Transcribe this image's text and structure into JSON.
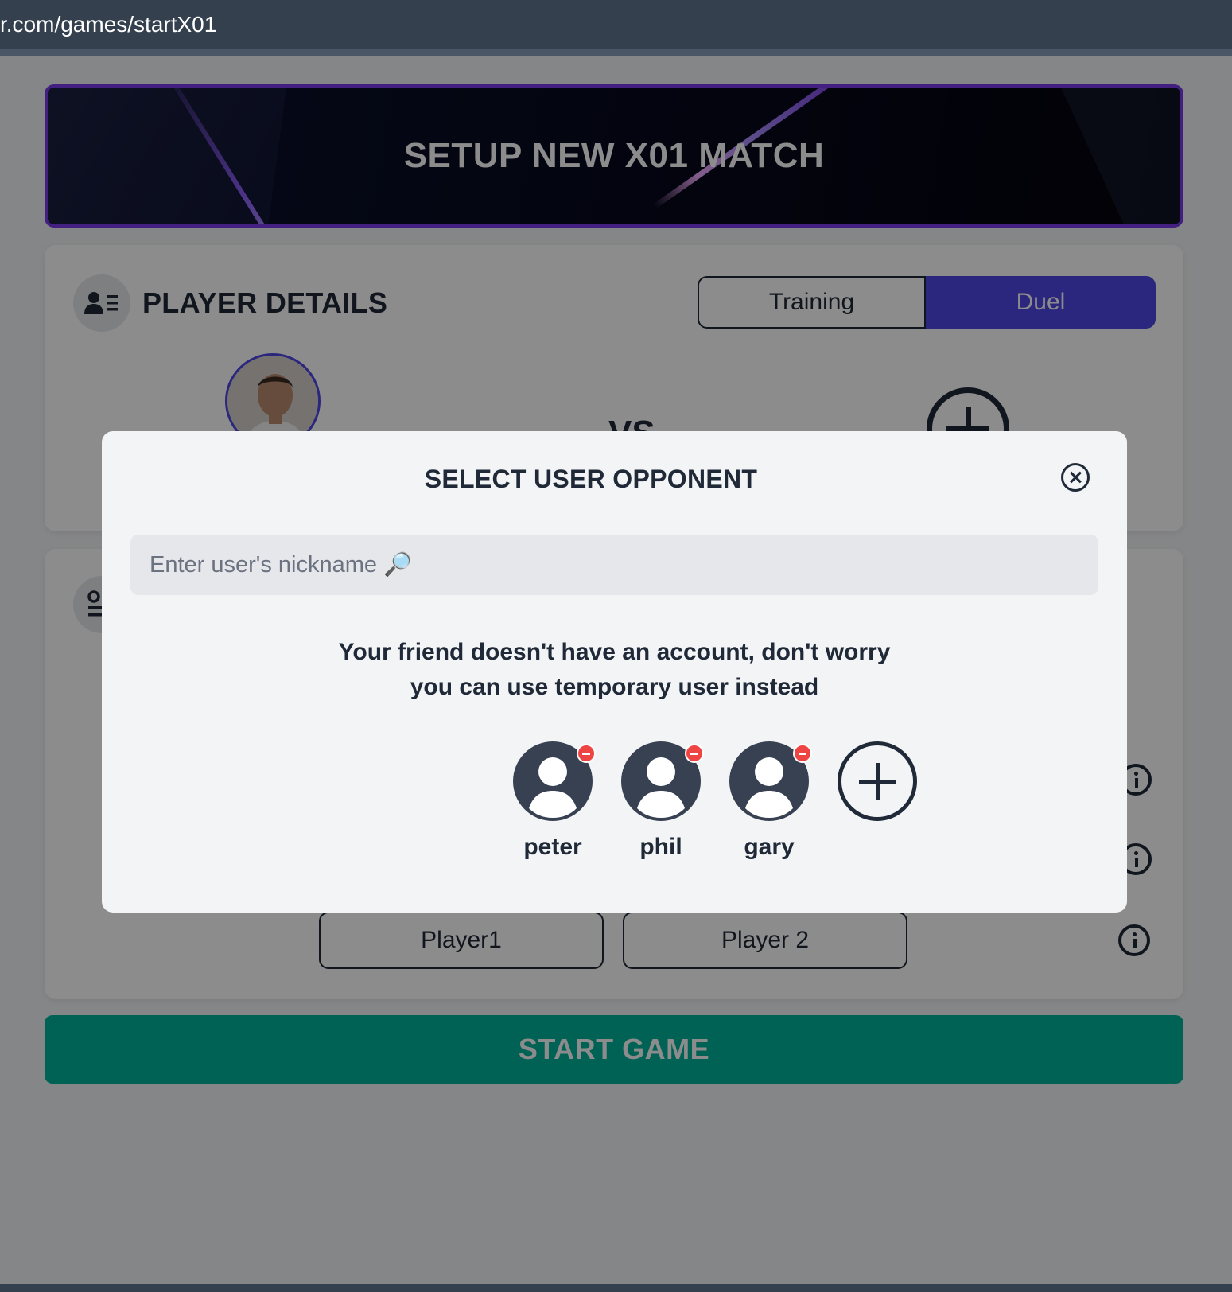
{
  "browser": {
    "url": "r.com/games/startX01"
  },
  "banner": {
    "title": "SETUP NEW X01 MATCH"
  },
  "player_details": {
    "title": "PLAYER DETAILS",
    "icon": "user-list-icon",
    "mode_options": [
      "Training",
      "Duel"
    ],
    "selected_mode": "Duel",
    "versus_label": "VS"
  },
  "game_settings": {
    "icon": "settings-user-icon",
    "player_names": [
      "Player1",
      "Player 2"
    ]
  },
  "start_button": {
    "label": "START GAME"
  },
  "modal": {
    "title": "SELECT USER OPPONENT",
    "search_placeholder": "Enter user's nickname 🔎",
    "hint_line1": "Your friend doesn't have an account, don't worry",
    "hint_line2": "you can use temporary user instead",
    "temporary_users": [
      {
        "name": "peter"
      },
      {
        "name": "phil"
      },
      {
        "name": "gary"
      }
    ]
  },
  "colors": {
    "accent": "#4f46e5",
    "banner_border": "#7c3aed",
    "start_button": "#00b39c",
    "remove_badge": "#ef4444",
    "text_dark": "#1f2937"
  }
}
